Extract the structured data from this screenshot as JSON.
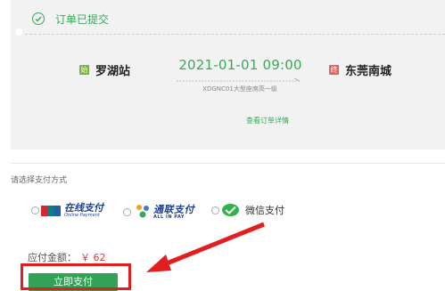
{
  "order": {
    "status_text": "订单已提交",
    "from_badge": "始",
    "from_station": "罗湖站",
    "to_badge": "终",
    "to_station": "东莞南城",
    "departure": "2021-01-01  09:00",
    "train_info": "XDGNC01大型座席高一级",
    "detail_link": "查看订单详情"
  },
  "payment": {
    "section_title": "请选择支付方式",
    "options": [
      {
        "name": "unionpay",
        "label": "在线支付",
        "sub": "Online Payment"
      },
      {
        "name": "allinpay",
        "label": "通联支付",
        "sub": "ALL IN PAY"
      },
      {
        "name": "wechat",
        "label": "微信支付"
      }
    ]
  },
  "amount": {
    "label": "应付金额：",
    "value": "￥ 62"
  },
  "pay_button_label": "立即支付",
  "colors": {
    "accent_green": "#3aa85b",
    "highlight_red": "#e21e1e",
    "panel_bg": "#f2f2f2"
  }
}
